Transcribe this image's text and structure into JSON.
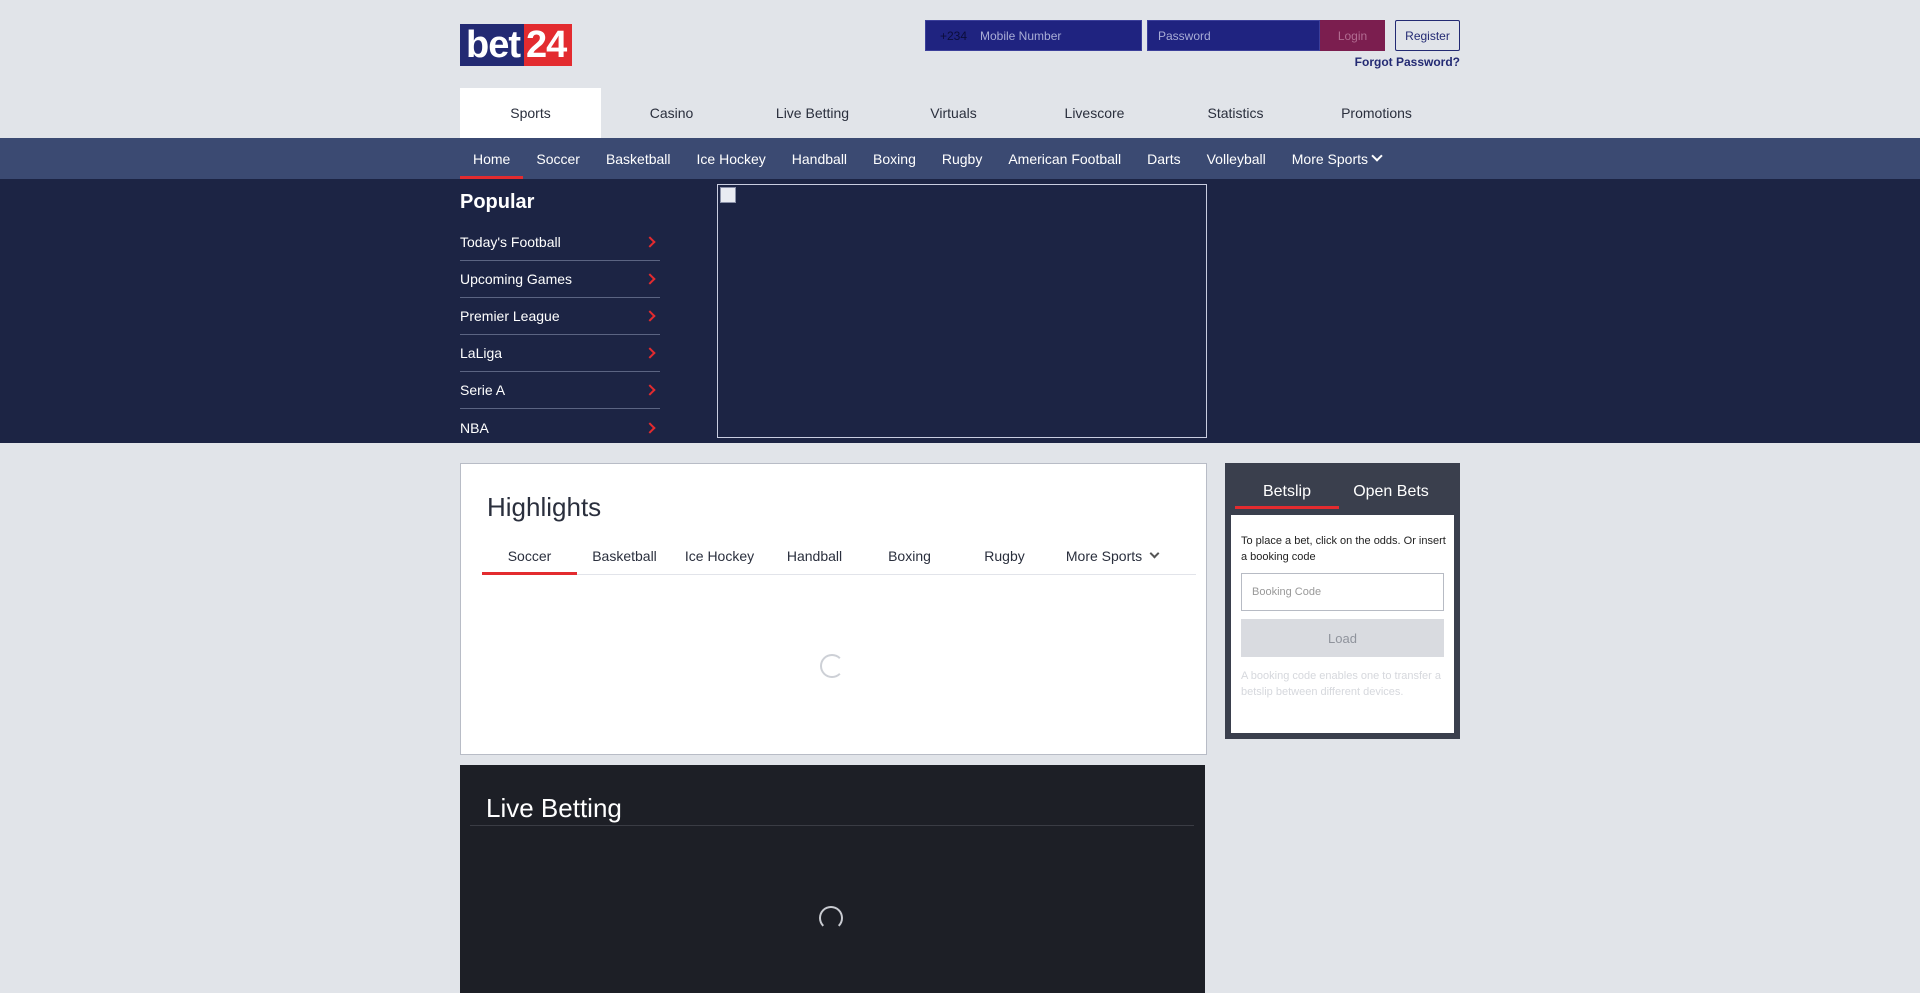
{
  "header": {
    "logo": {
      "part1": "bet",
      "part2": "24"
    },
    "mobile_prefix": "+234",
    "mobile_placeholder": "Mobile Number",
    "password_placeholder": "Password",
    "login_label": "Login",
    "register_label": "Register",
    "forgot_label": "Forgot Password?"
  },
  "top_nav": [
    "Sports",
    "Casino",
    "Live Betting",
    "Virtuals",
    "Livescore",
    "Statistics",
    "Promotions"
  ],
  "sub_nav": {
    "items": [
      "Home",
      "Soccer",
      "Basketball",
      "Ice Hockey",
      "Handball",
      "Boxing",
      "Rugby",
      "American Football",
      "Darts",
      "Volleyball"
    ],
    "more": "More Sports"
  },
  "popular": {
    "title": "Popular",
    "items": [
      "Today's Football",
      "Upcoming Games",
      "Premier League",
      "LaLiga",
      "Serie A",
      "NBA"
    ]
  },
  "highlights": {
    "title": "Highlights",
    "tabs": [
      "Soccer",
      "Basketball",
      "Ice Hockey",
      "Handball",
      "Boxing",
      "Rugby"
    ],
    "more": "More Sports"
  },
  "betslip": {
    "tabs": [
      "Betslip",
      "Open Bets"
    ],
    "info": "To place a bet, click on the odds. Or insert a booking code",
    "booking_placeholder": "Booking Code",
    "load_label": "Load",
    "note": "A booking code enables one to transfer a betslip between different devices."
  },
  "live_betting": {
    "title": "Live Betting"
  },
  "colors": {
    "brand_blue": "#232a73",
    "brand_red": "#e32b2f",
    "subnav": "#3b4a72",
    "hero": "#1c2444"
  }
}
